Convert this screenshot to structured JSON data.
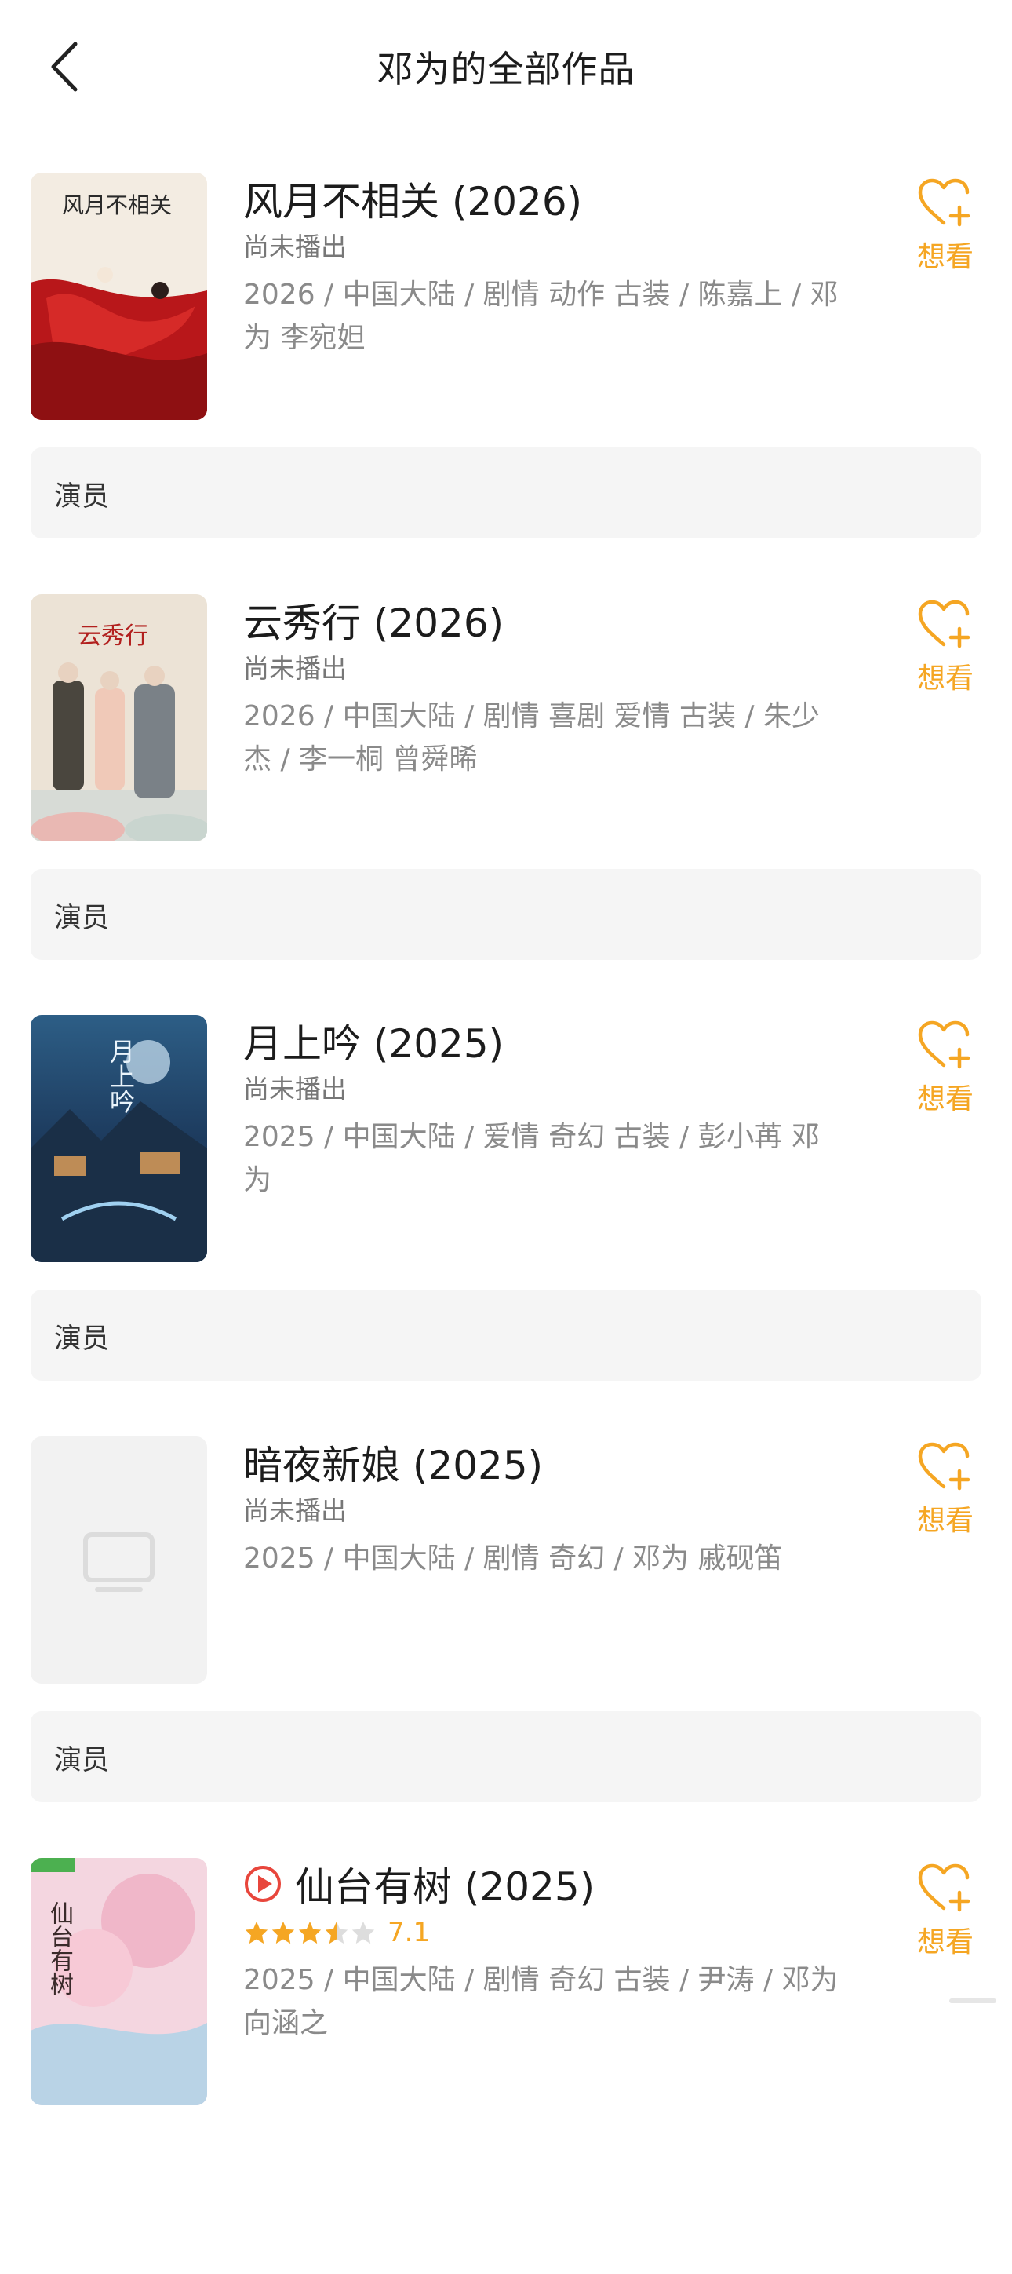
{
  "header": {
    "title": "邓为的全部作品",
    "back_icon": "chevron-left-icon"
  },
  "works": [
    {
      "title": "风月不相关 (2026)",
      "status": "尚未播出",
      "meta": "2026 / 中国大陆 / 剧情 动作 古装 / 陈嘉上 / 邓为 李宛妲",
      "want_label": "想看",
      "role": "演员",
      "poster_text": "风月不相关"
    },
    {
      "title": "云秀行 (2026)",
      "status": "尚未播出",
      "meta": "2026 / 中国大陆 / 剧情 喜剧 爱情 古装 / 朱少杰 / 李一桐 曾舜晞",
      "want_label": "想看",
      "role": "演员",
      "poster_text": "云秀行"
    },
    {
      "title": "月上吟 (2025)",
      "status": "尚未播出",
      "meta": "2025 / 中国大陆 / 爱情 奇幻 古装 / 彭小苒 邓为",
      "want_label": "想看",
      "role": "演员",
      "poster_text": "月上吟"
    },
    {
      "title": "暗夜新娘 (2025)",
      "status": "尚未播出",
      "meta": "2025 / 中国大陆 / 剧情 奇幻 / 邓为 戚砚笛",
      "want_label": "想看",
      "role": "演员"
    },
    {
      "title": "仙台有树 (2025)",
      "rating": "7.1",
      "rating_stars": 3.5,
      "meta": "2025 / 中国大陆 / 剧情 奇幻 古装 / 尹涛 / 邓为 向涵之",
      "want_label": "想看",
      "poster_text": "仙台有树"
    }
  ],
  "colors": {
    "accent": "#f5a623",
    "play_red": "#e8463c",
    "role_bg": "#f5f5f5"
  }
}
